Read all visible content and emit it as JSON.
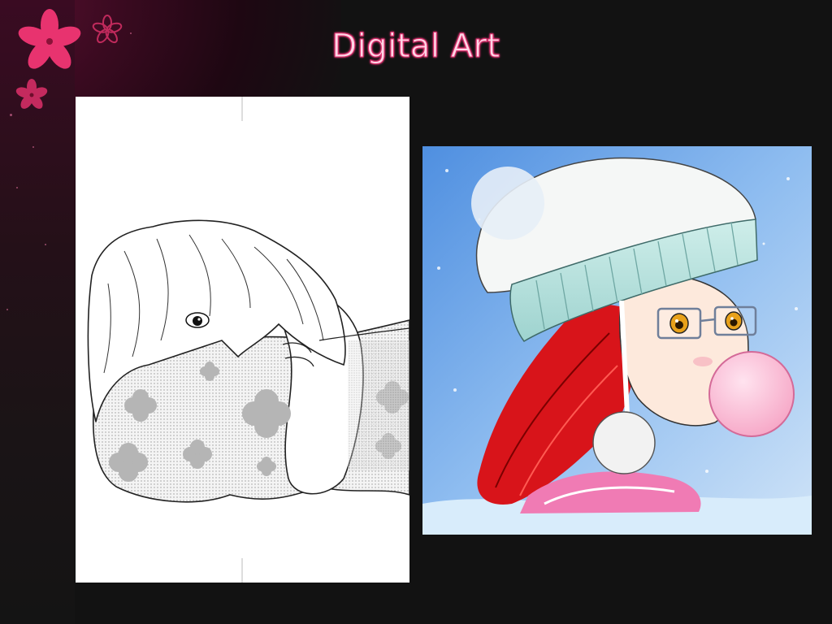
{
  "slide": {
    "title": "Digital Art"
  },
  "images": [
    {
      "icon": "manga-girl-pillow-sketch-image"
    },
    {
      "icon": "girl-beanie-bubblegum-image"
    }
  ],
  "decorations": {
    "flower_color": "#e8336f",
    "title_color": "#ffd6e6",
    "title_outline": "#e0306e",
    "background": "#121212"
  }
}
